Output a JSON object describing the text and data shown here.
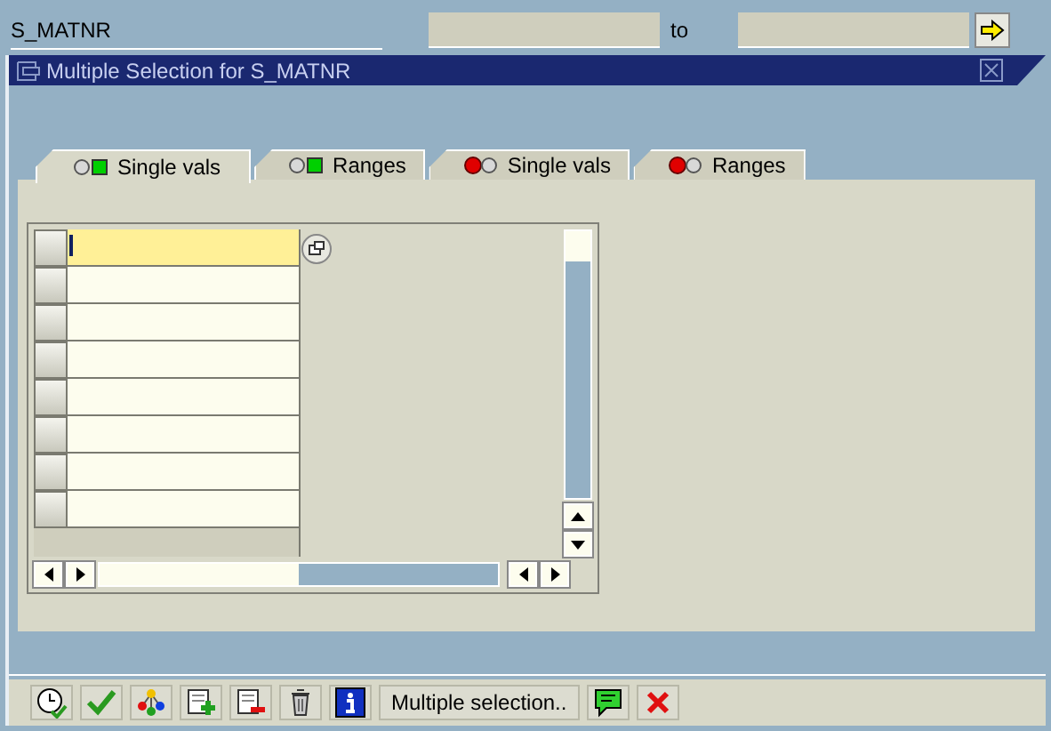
{
  "selection_field": {
    "label": "S_MATNR",
    "to_label": "to"
  },
  "dialog": {
    "title": "Multiple Selection for S_MATNR"
  },
  "tabs": [
    {
      "label": "Single vals",
      "included": true,
      "selected": true
    },
    {
      "label": "Ranges",
      "included": true,
      "selected": false
    },
    {
      "label": "Single vals",
      "included": false,
      "selected": false
    },
    {
      "label": "Ranges",
      "included": false,
      "selected": false
    }
  ],
  "table": {
    "rows": [
      {
        "selected": true
      },
      {
        "selected": false
      },
      {
        "selected": false
      },
      {
        "selected": false
      },
      {
        "selected": false
      },
      {
        "selected": false
      },
      {
        "selected": false
      },
      {
        "selected": false
      }
    ]
  },
  "toolbar": [
    {
      "kind": "execute"
    },
    {
      "kind": "check"
    },
    {
      "kind": "tree"
    },
    {
      "kind": "insert-row"
    },
    {
      "kind": "delete-row"
    },
    {
      "kind": "trash"
    },
    {
      "kind": "info"
    },
    {
      "kind": "text",
      "label": "Multiple selection.."
    },
    {
      "kind": "import"
    },
    {
      "kind": "cancel"
    }
  ]
}
